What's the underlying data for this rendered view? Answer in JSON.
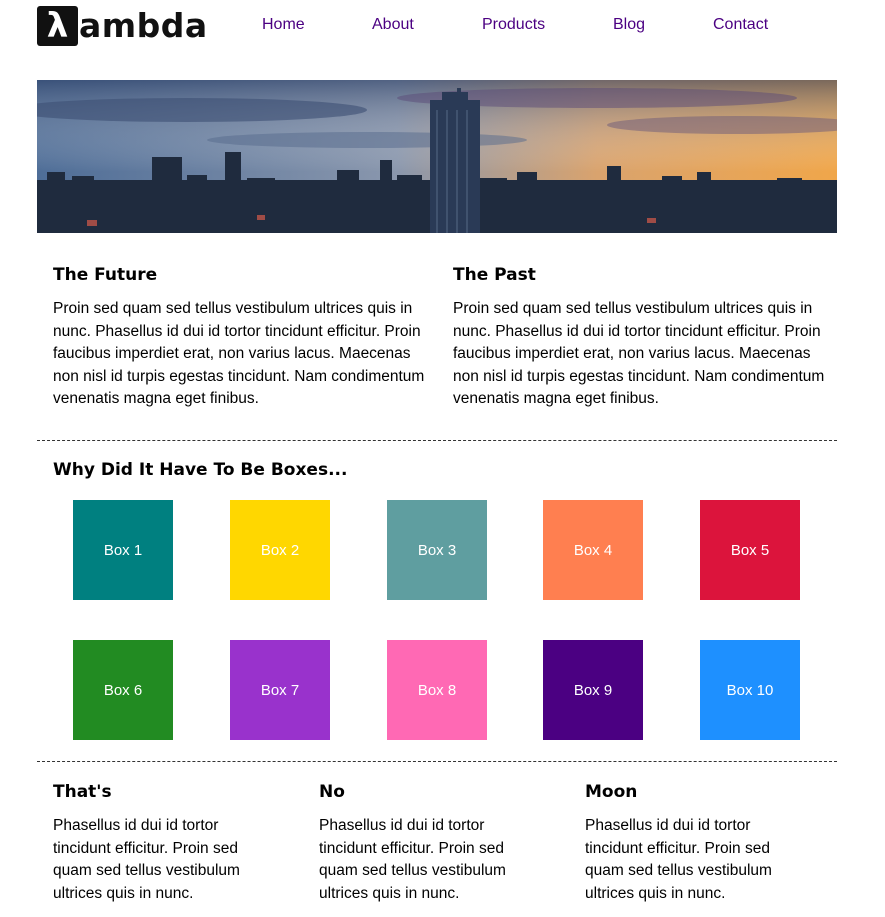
{
  "logo": {
    "mark": "λ",
    "text": "ambda"
  },
  "nav": {
    "items": [
      "Home",
      "About",
      "Products",
      "Blog",
      "Contact"
    ]
  },
  "top_columns": [
    {
      "title": "The Future",
      "text": "Proin sed quam sed tellus vestibulum ultrices quis in nunc. Phasellus id dui id tortor tincidunt efficitur. Proin faucibus imperdiet erat, non varius lacus. Maecenas non nisl id turpis egestas tincidunt. Nam condimentum venenatis magna eget finibus."
    },
    {
      "title": "The Past",
      "text": "Proin sed quam sed tellus vestibulum ultrices quis in nunc. Phasellus id dui id tortor tincidunt efficitur. Proin faucibus imperdiet erat, non varius lacus. Maecenas non nisl id turpis egestas tincidunt. Nam condimentum venenatis magna eget finibus."
    }
  ],
  "boxes_section": {
    "title": "Why Did It Have To Be Boxes...",
    "boxes": [
      {
        "label": "Box 1",
        "color": "#008080"
      },
      {
        "label": "Box 2",
        "color": "#ffd700"
      },
      {
        "label": "Box 3",
        "color": "#5f9ea0"
      },
      {
        "label": "Box 4",
        "color": "#ff7f50"
      },
      {
        "label": "Box 5",
        "color": "#dc143c"
      },
      {
        "label": "Box 6",
        "color": "#228b22"
      },
      {
        "label": "Box 7",
        "color": "#9932cc"
      },
      {
        "label": "Box 8",
        "color": "#ff69b4"
      },
      {
        "label": "Box 9",
        "color": "#4b0082"
      },
      {
        "label": "Box 10",
        "color": "#1e90ff"
      }
    ]
  },
  "bottom_columns": [
    {
      "title": "That's",
      "text": "Phasellus id dui id tortor tincidunt efficitur. Proin sed quam sed tellus vestibulum ultrices quis in nunc."
    },
    {
      "title": "No",
      "text": "Phasellus id dui id tortor tincidunt efficitur. Proin sed quam sed tellus vestibulum ultrices quis in nunc."
    },
    {
      "title": "Moon",
      "text": "Phasellus id dui id tortor tincidunt efficitur. Proin sed quam sed tellus vestibulum ultrices quis in nunc."
    }
  ],
  "colors": {
    "nav_link": "#4b0082"
  }
}
